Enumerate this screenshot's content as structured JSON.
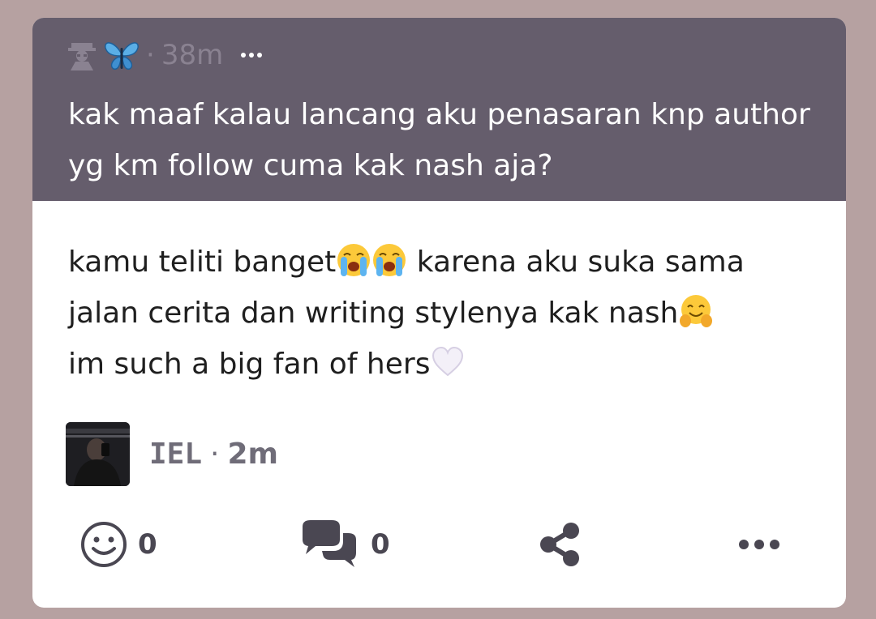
{
  "question": {
    "meta_icons": [
      "spy-icon",
      "butterfly-icon"
    ],
    "separator": "·",
    "time": "38m",
    "text": "kak maaf kalau lancang aku penasaran knp author yg km follow cuma kak nash aja?"
  },
  "answer": {
    "line1_a": "kamu teliti banget",
    "line1_b": " karena aku suka sama",
    "line2": "jalan cerita dan writing stylenya kak nash",
    "line3": "im such a big fan of hers",
    "emojis": [
      "loudly-crying-face",
      "loudly-crying-face",
      "hugging-face",
      "white-heart"
    ]
  },
  "author": {
    "name": "IEL",
    "separator": "·",
    "time": "2m"
  },
  "actions": {
    "react_count": "0",
    "comment_count": "0"
  },
  "colors": {
    "background": "#b6a1a1",
    "question_bg": "#655d6c",
    "card_bg": "#ffffff",
    "action_icon": "#4a4752"
  }
}
